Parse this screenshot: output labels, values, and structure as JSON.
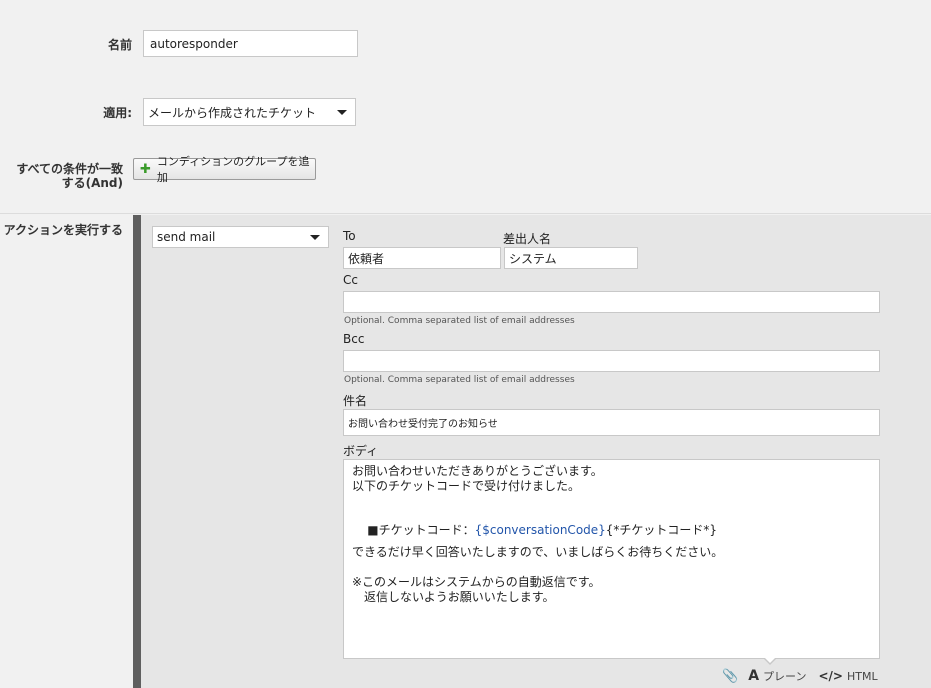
{
  "fields": {
    "name_label": "名前",
    "name_value": "autoresponder",
    "apply_label": "適用:",
    "apply_value": "メールから作成されたチケット",
    "conditions_label_line1": "すべての条件が一致",
    "conditions_label_line2": "する(And)",
    "add_condition_button": "コンディションのグループを追加",
    "actions_label": "アクションを実行する"
  },
  "action": {
    "type_value": "send mail",
    "to_label": "To",
    "to_value": "依頼者",
    "sender_label": "差出人名",
    "sender_value": "システム",
    "cc_label": "Cc",
    "cc_value": "",
    "cc_hint": "Optional. Comma separated list of email addresses",
    "bcc_label": "Bcc",
    "bcc_value": "",
    "bcc_hint": "Optional. Comma separated list of email addresses",
    "subject_label": "件名",
    "subject_value": "お問い合わせ受付完了のお知らせ",
    "body_label": "ボディ",
    "body": {
      "line1": "お問い合わせいただきありがとうございます。",
      "line2": "以下のチケットコードで受け付けました。",
      "line3_prefix": "■チケットコード：",
      "line3_token": "{$conversationCode}",
      "line3_suffix": "{*チケットコード*}",
      "line4": "できるだけ早く回答いたしますので、いましばらくお待ちください。",
      "line5": "※このメールはシステムからの自動返信です。",
      "line6": "　返信しないようお願いいたします。"
    },
    "format": {
      "plain_label": "プレーン",
      "html_label": "HTML"
    }
  },
  "icons": {
    "attach": "paperclip-icon",
    "plain": "text-a-icon",
    "html": "code-icon",
    "add": "plus-icon"
  }
}
